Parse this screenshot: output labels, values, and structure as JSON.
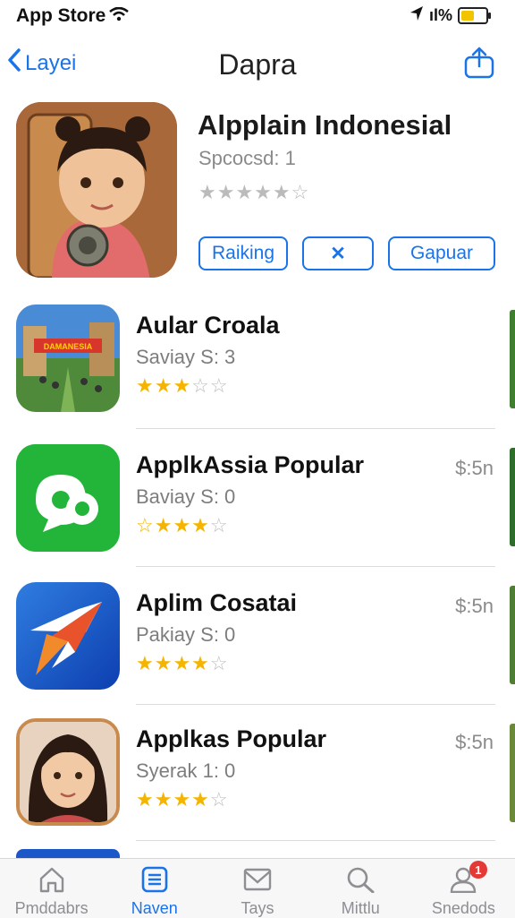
{
  "status_bar": {
    "carrier": "App Store",
    "battery_text": "ıl%"
  },
  "nav": {
    "back_label": "Layei",
    "title": "Dapra"
  },
  "featured": {
    "title": "Alpplain Indonesial",
    "subtitle": "Spcocsd: 1",
    "stars": "★★★★★☆",
    "buttons": [
      "Raiking",
      "✕",
      "Gapuar"
    ]
  },
  "apps": [
    {
      "name": "Aular Croala",
      "meta": "Saviay S: 3",
      "stars_on": "★★★",
      "stars_off": "☆☆",
      "price": "",
      "banner": "DAMANESIA"
    },
    {
      "name": "ApplkAssia Popular",
      "meta": "Baviay S: 0",
      "stars_on": "☆★★★",
      "stars_off": "☆",
      "price": "$:5n"
    },
    {
      "name": "Aplim Cosatai",
      "meta": "Pakiay S: 0",
      "stars_on": "★★★★",
      "stars_off": "☆",
      "price": "$:5n"
    },
    {
      "name": "Applkas Popular",
      "meta": "Syerak 1: 0",
      "stars_on": "★★★★",
      "stars_off": "☆",
      "price": "$:5n"
    }
  ],
  "tabs": [
    {
      "label": "Pmddabrs",
      "icon": "home-icon"
    },
    {
      "label": "Naven",
      "icon": "document-icon"
    },
    {
      "label": "Tays",
      "icon": "mail-icon"
    },
    {
      "label": "Mittlu",
      "icon": "search-icon"
    },
    {
      "label": "Snedods",
      "icon": "person-icon"
    }
  ],
  "badge_count": "1",
  "colors": {
    "accent": "#1a73e8",
    "star": "#f4b400",
    "badge": "#e53935"
  }
}
